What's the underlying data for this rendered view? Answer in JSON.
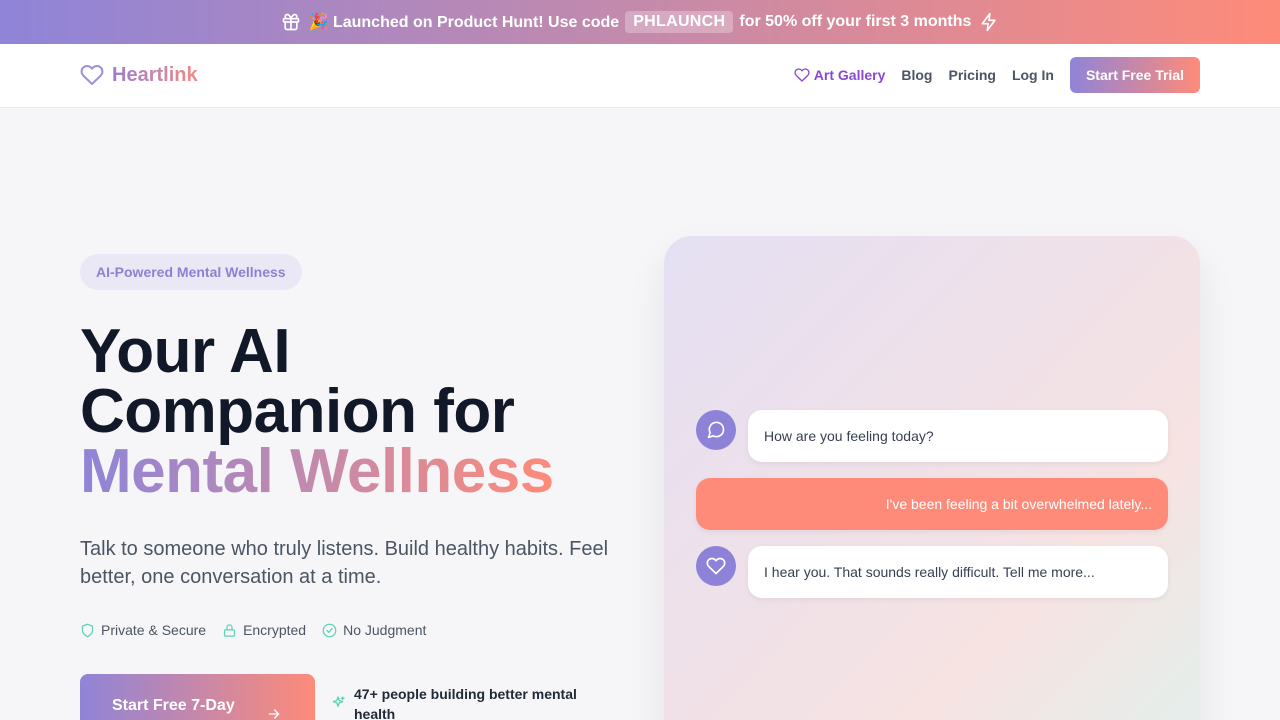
{
  "promo": {
    "text_before": "🎉 Launched on Product Hunt! Use code",
    "code": "PHLAUNCH",
    "text_after": "for 50% off your first 3 months",
    "icons": [
      "gift-icon",
      "zap-icon"
    ]
  },
  "header": {
    "brand": "Heartlink",
    "nav": {
      "gallery": "Art Gallery",
      "blog": "Blog",
      "pricing": "Pricing",
      "login": "Log In",
      "cta": "Start Free Trial"
    }
  },
  "hero": {
    "badge": "AI-Powered Mental Wellness",
    "headline_line1": "Your AI",
    "headline_line2": "Companion for",
    "headline_gradient": "Mental Wellness",
    "subhead": "Talk to someone who truly listens. Build healthy habits. Feel better, one conversation at a time.",
    "trust": [
      {
        "label": "Private & Secure",
        "icon": "shield-icon"
      },
      {
        "label": "Encrypted",
        "icon": "lock-icon"
      },
      {
        "label": "No Judgment",
        "icon": "check-circle-icon"
      }
    ],
    "start_button": "Start Free 7-Day",
    "social_proof": "47+ people building better mental health"
  },
  "chat": {
    "messages": [
      {
        "from": "ai",
        "text": "How are you feeling today?",
        "icon": "message-circle-icon"
      },
      {
        "from": "user",
        "text": "I've been feeling a bit overwhelmed lately..."
      },
      {
        "from": "ai",
        "text": "I hear you. That sounds really difficult. Tell me more...",
        "icon": "heart-icon"
      }
    ]
  },
  "colors": {
    "accent_start": "#8f84d8",
    "accent_end": "#fe8b79",
    "gallery_link": "#8b47d6",
    "trust_icon": "#5fd3b3"
  }
}
